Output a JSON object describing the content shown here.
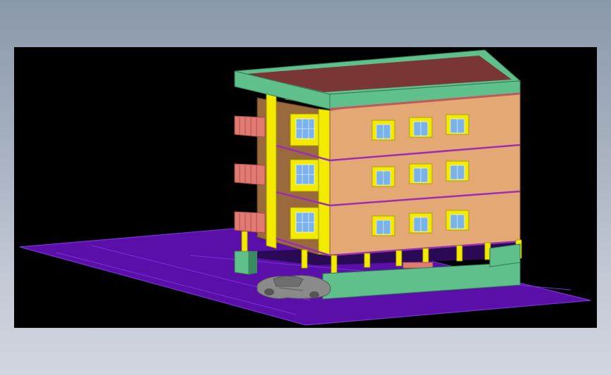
{
  "viewport": {
    "background": "#000000",
    "description_hidden": ""
  },
  "palette": {
    "ground": "#5a10a8",
    "ground_edge": "#7a30d8",
    "wall_front": "#e3a873",
    "wall_side": "#9b6a3c",
    "roof": "#7a3535",
    "parapet": "#5fc08c",
    "yellow": "#f2ea00",
    "window": "#79b3ea",
    "balcony": "#e07a72",
    "boundary_wall": "#5fc08c",
    "car": "#8a8a8a",
    "floor_band": "#9a2fb0"
  },
  "icons": {
    "car": "car-model-icon"
  }
}
